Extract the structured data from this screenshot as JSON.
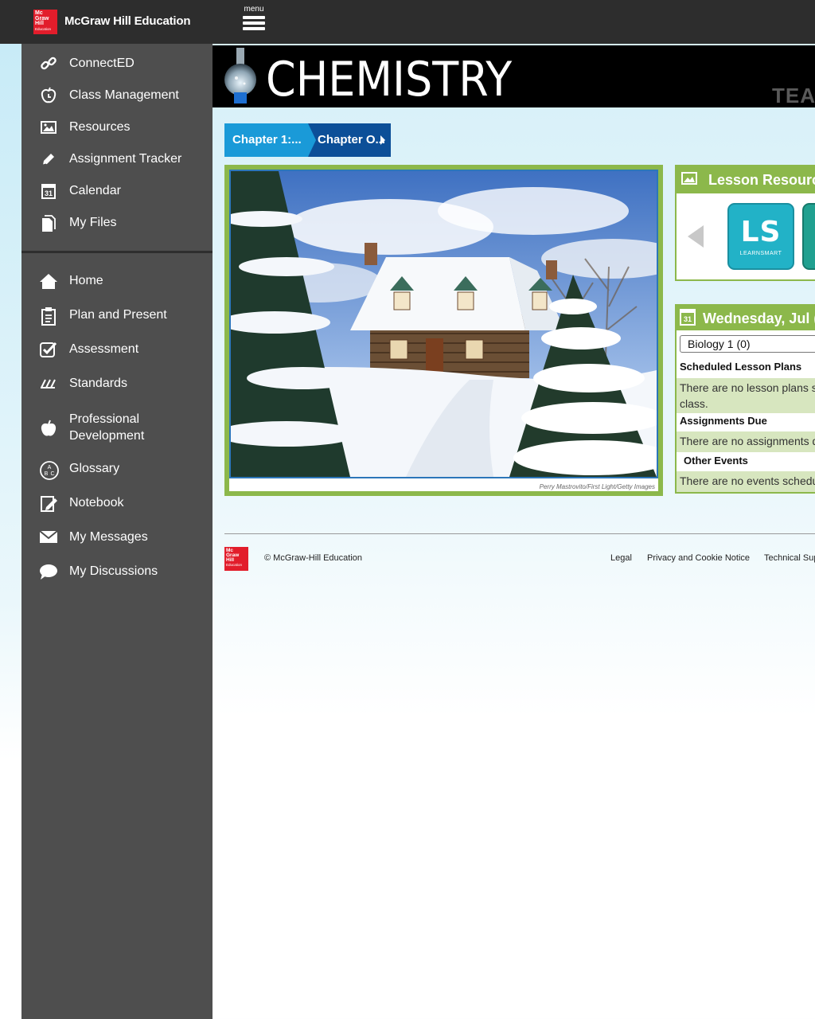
{
  "header": {
    "logo_lines": [
      "Mc",
      "Graw",
      "Hill",
      "Education"
    ],
    "brand": "McGraw Hill Education",
    "menu_label": "menu"
  },
  "sidebar": {
    "top_items": [
      {
        "label": "ConnectED",
        "icon": "link-icon"
      },
      {
        "label": "Class Management",
        "icon": "apple-clock-icon"
      },
      {
        "label": "Resources",
        "icon": "image-icon"
      },
      {
        "label": "Assignment Tracker",
        "icon": "pencil-icon"
      },
      {
        "label": "Calendar",
        "icon": "calendar-icon"
      },
      {
        "label": "My Files",
        "icon": "files-icon"
      }
    ],
    "bottom_items": [
      {
        "label": "Home",
        "icon": "home-icon"
      },
      {
        "label": "Plan and Present",
        "icon": "clipboard-icon"
      },
      {
        "label": "Assessment",
        "icon": "checkbox-icon"
      },
      {
        "label": "Standards",
        "icon": "slashes-icon"
      },
      {
        "label": "Professional Development",
        "icon": "apple-icon"
      },
      {
        "label": "Glossary",
        "icon": "abc-icon"
      },
      {
        "label": "Notebook",
        "icon": "notebook-icon"
      },
      {
        "label": "My Messages",
        "icon": "envelope-icon"
      },
      {
        "label": "My Discussions",
        "icon": "speech-bubble-icon"
      }
    ],
    "glossary_icon_text": "A B C",
    "calendar_icon_text": "31"
  },
  "banner": {
    "title": "CHEMISTRY",
    "badge_partial": "TEA"
  },
  "breadcrumb": {
    "items": [
      "Chapter 1:...",
      "Chapter O..."
    ]
  },
  "photo": {
    "credit": "Perry Mastrovito/First Light/Getty Images"
  },
  "lesson_resources": {
    "title": "Lesson Resource",
    "tile_main": "LS",
    "tile_sub": "LEARNSMART"
  },
  "calendar_panel": {
    "icon_text": "31",
    "date_title": "Wednesday, Jul (",
    "selected_class": "Biology 1 (0)",
    "sections": [
      {
        "heading": "Scheduled Lesson Plans",
        "message_lines": [
          "There are no lesson plans s",
          "class."
        ]
      },
      {
        "heading": "Assignments Due",
        "message_lines": [
          "There are no assignments d"
        ]
      },
      {
        "heading": "Other Events",
        "message_lines": [
          "There are no events schedu"
        ]
      }
    ]
  },
  "footer": {
    "logo_lines": [
      "Mc",
      "Graw",
      "Hill",
      "Education"
    ],
    "copyright": "© McGraw-Hill Education",
    "links": [
      "Legal",
      "Privacy and Cookie Notice",
      "Technical Sup"
    ]
  },
  "colors": {
    "topbar": "#2d2d2d",
    "sidebar": "#4e4e4e",
    "accent_green": "#8cb84b",
    "crumb_light": "#1a9ad8",
    "crumb_dark": "#0c4f98",
    "brand_red": "#e21d2b"
  }
}
